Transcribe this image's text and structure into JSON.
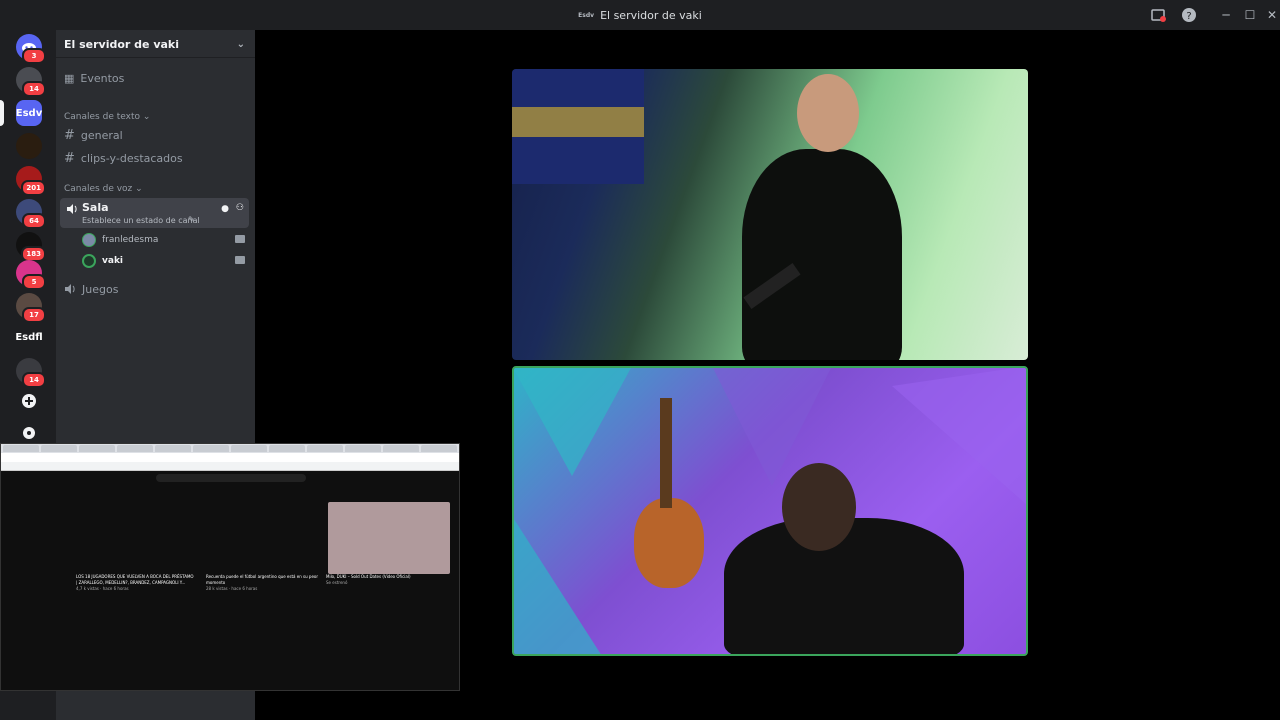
{
  "window": {
    "title": "El servidor de vaki",
    "server_abbr": "Esdv"
  },
  "rail": {
    "badges": [
      "3",
      "14",
      "201",
      "64",
      "183",
      "5",
      "17",
      "14"
    ],
    "active_server": "Esdv",
    "text_server": "Esdfl"
  },
  "sidebar": {
    "server_name": "El servidor de vaki",
    "events_label": "Eventos",
    "text_category": "Canales de texto",
    "text_channels": [
      "general",
      "clips-y-destacados"
    ],
    "voice_category": "Canales de voz",
    "voice_channel": {
      "name": "Sala",
      "status": "Establece un estado de canal",
      "members": [
        "franledesma",
        "vaki"
      ]
    },
    "other_voice": "Juegos"
  },
  "share": {
    "videos": [
      {
        "title": "LOS 18 JUGADORES QUE VUELVEN A BOCA DEL PRÉSTAMO | ZARALLEGO, MEDELLIN?, BRANDEZ, CAMPAGNOLI Y...",
        "meta": "4,7 k vistas · hace 6 horas"
      },
      {
        "title": "Recuerda puede el fútbol argentino que está en su peor momento",
        "meta": "28 k vistas · hace 6 horas"
      },
      {
        "title": "Milo, DUKI – Sold Out Dates (Video Oficial)",
        "meta": "Se estrenó"
      }
    ]
  },
  "colors": {
    "accent": "#5865f2",
    "speaking": "#3ba55c",
    "badge": "#f23f43"
  }
}
